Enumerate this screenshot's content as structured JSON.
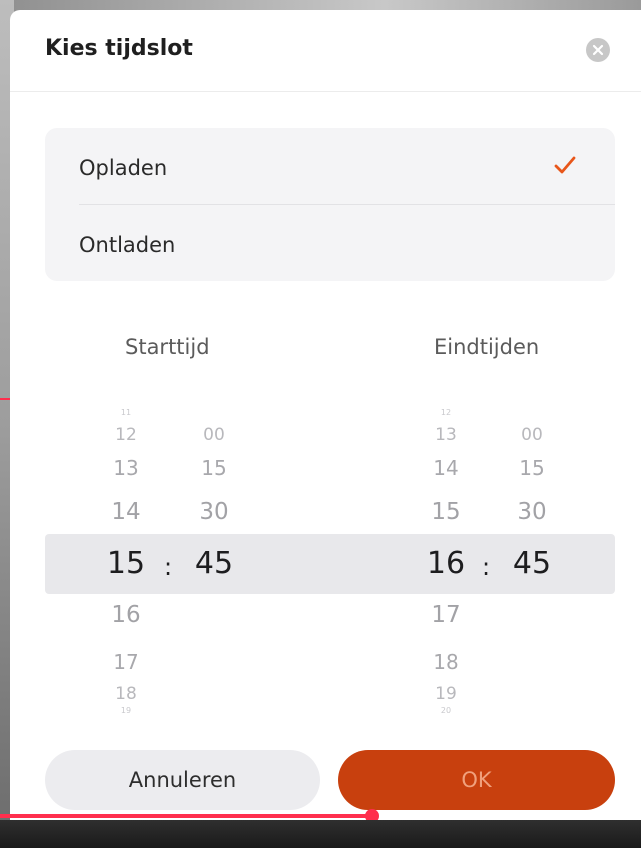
{
  "dialog": {
    "title": "Kies tijdslot",
    "close_icon": "close-icon"
  },
  "modes": [
    {
      "label": "Opladen",
      "selected": true
    },
    {
      "label": "Ontladen",
      "selected": false
    }
  ],
  "accent_color": "#e8561a",
  "start": {
    "heading": "Starttijd",
    "hours_above": [
      "11",
      "12",
      "13",
      "14"
    ],
    "hour_selected": "15",
    "hours_below": [
      "16",
      "17",
      "18",
      "19"
    ],
    "minutes_above": [
      "00",
      "15",
      "30"
    ],
    "minute_selected": "45"
  },
  "end": {
    "heading": "Eindtijden",
    "hours_above": [
      "12",
      "13",
      "14",
      "15"
    ],
    "hour_selected": "16",
    "hours_below": [
      "17",
      "18",
      "19",
      "20"
    ],
    "minutes_above": [
      "00",
      "15",
      "30"
    ],
    "minute_selected": "45"
  },
  "separator": ":",
  "buttons": {
    "cancel": "Annuleren",
    "ok": "OK"
  },
  "video_progress": 0.58
}
